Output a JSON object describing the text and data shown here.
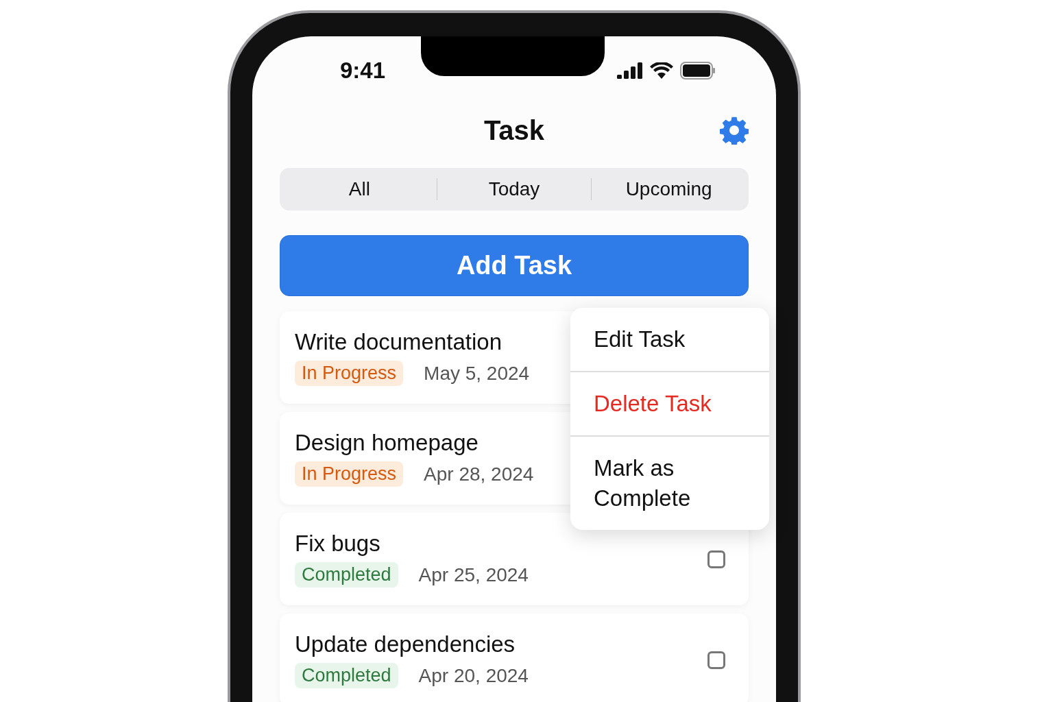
{
  "status_bar": {
    "time": "9:41"
  },
  "header": {
    "title": "Task"
  },
  "tabs": [
    {
      "label": "All",
      "selected": false
    },
    {
      "label": "Today",
      "selected": false
    },
    {
      "label": "Upcoming",
      "selected": false
    }
  ],
  "add_button": {
    "label": "Add Task"
  },
  "tasks": [
    {
      "title": "Write documentation",
      "status": "In Progress",
      "kind": "in_progress",
      "date": "May 5, 2024"
    },
    {
      "title": "Design homepage",
      "status": "In Progress",
      "kind": "in_progress",
      "date": "Apr 28, 2024"
    },
    {
      "title": "Fix bugs",
      "status": "Completed",
      "kind": "completed",
      "date": "Apr 25, 2024",
      "checked": false
    },
    {
      "title": "Update dependencies",
      "status": "Completed",
      "kind": "completed",
      "date": "Apr 20, 2024",
      "checked": false
    }
  ],
  "context_menu": [
    {
      "label": "Edit Task",
      "kind": "normal"
    },
    {
      "label": "Delete Task",
      "kind": "destructive"
    },
    {
      "label": "Mark as Complete",
      "kind": "normal"
    }
  ]
}
